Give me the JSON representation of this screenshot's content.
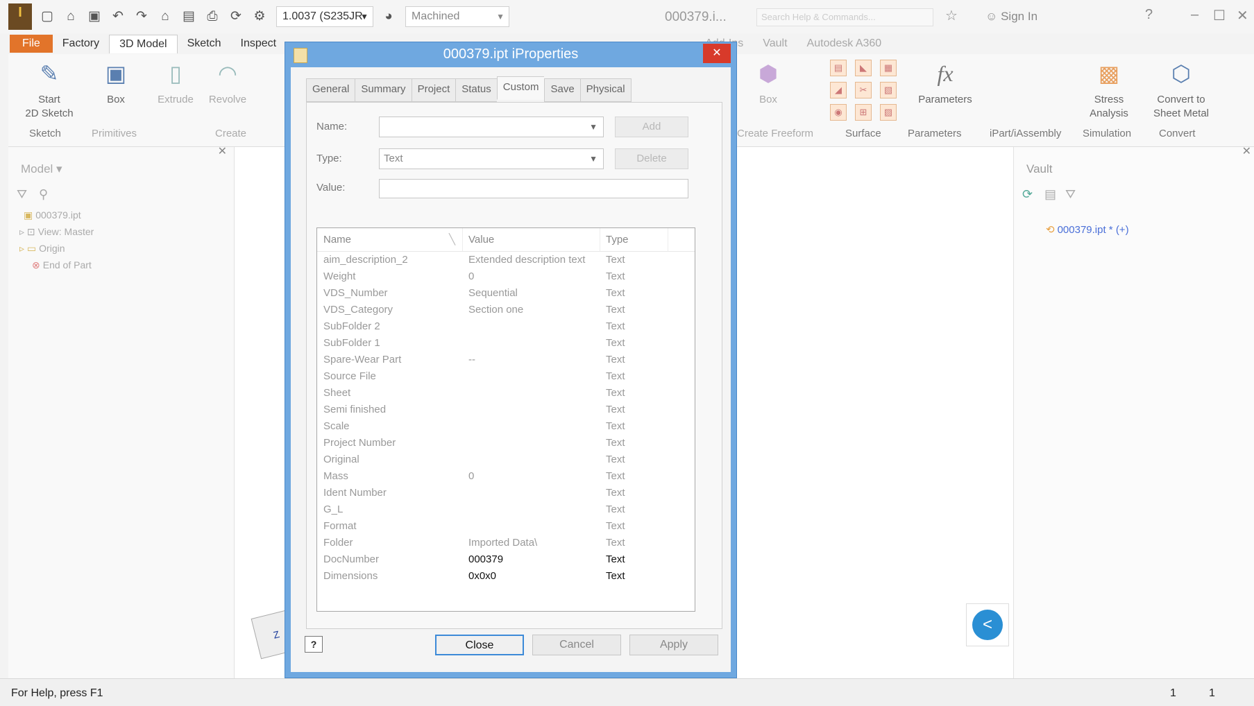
{
  "titlebar": {
    "material": "1.0037 (S235JR",
    "appearance": "Machined",
    "title": "000379.i...",
    "search_placeholder": "Search Help & Commands...",
    "sign_in": "Sign In"
  },
  "ribbon_tabs": [
    "File",
    "Factory",
    "3D Model",
    "Sketch",
    "Inspect",
    "Add-Ins",
    "Vault",
    "Autodesk A360"
  ],
  "ribbon": {
    "start_sketch": [
      "Start",
      "2D Sketch"
    ],
    "box": "Box",
    "extrude": "Extrude",
    "revolve": "Revolve",
    "freeform_box": "Box",
    "parameters": "Parameters",
    "stress": [
      "Stress",
      "Analysis"
    ],
    "sheetmetal": [
      "Convert to",
      "Sheet Metal"
    ],
    "panels": {
      "sketch": "Sketch",
      "primitives": "Primitives",
      "create": "Create",
      "create_freeform": "Create Freeform",
      "surface": "Surface",
      "parameters": "Parameters",
      "ipart": "iPart/iAssembly",
      "simulation": "Simulation",
      "convert": "Convert"
    }
  },
  "model_browser": {
    "title": "Model",
    "items": [
      "000379.ipt",
      "View: Master",
      "Origin",
      "End of Part"
    ]
  },
  "vault_panel": {
    "title": "Vault",
    "item": "000379.ipt * (+)"
  },
  "statusbar": {
    "help": "For Help, press F1",
    "n1": "1",
    "n2": "1"
  },
  "dialog": {
    "title": "000379.ipt iProperties",
    "tabs": [
      "General",
      "Summary",
      "Project",
      "Status",
      "Custom",
      "Save",
      "Physical"
    ],
    "active_tab": "Custom",
    "name_label": "Name:",
    "type_label": "Type:",
    "value_label": "Value:",
    "type_value": "Text",
    "add_label": "Add",
    "delete_label": "Delete",
    "columns": [
      "Name",
      "Value",
      "Type"
    ],
    "rows": [
      {
        "name": "aim_description_2",
        "value": "Extended description text",
        "type": "Text"
      },
      {
        "name": "Weight",
        "value": "0",
        "type": "Text"
      },
      {
        "name": "VDS_Number",
        "value": "Sequential",
        "type": "Text"
      },
      {
        "name": "VDS_Category",
        "value": "Section one",
        "type": "Text"
      },
      {
        "name": "SubFolder 2",
        "value": "",
        "type": "Text"
      },
      {
        "name": "SubFolder 1",
        "value": "",
        "type": "Text"
      },
      {
        "name": "Spare-Wear Part",
        "value": "--",
        "type": "Text"
      },
      {
        "name": "Source File",
        "value": "",
        "type": "Text"
      },
      {
        "name": "Sheet",
        "value": "",
        "type": "Text"
      },
      {
        "name": "Semi finished",
        "value": "",
        "type": "Text"
      },
      {
        "name": "Scale",
        "value": "",
        "type": "Text"
      },
      {
        "name": "Project Number",
        "value": "",
        "type": "Text"
      },
      {
        "name": "Original",
        "value": "",
        "type": "Text"
      },
      {
        "name": "Mass",
        "value": "0",
        "type": "Text"
      },
      {
        "name": "Ident Number",
        "value": "",
        "type": "Text"
      },
      {
        "name": "G_L",
        "value": "",
        "type": "Text"
      },
      {
        "name": "Format",
        "value": "",
        "type": "Text"
      },
      {
        "name": "Folder",
        "value": "Imported Data\\",
        "type": "Text"
      },
      {
        "name": "DocNumber",
        "value": "000379",
        "type": "Text"
      },
      {
        "name": "Dimensions",
        "value": "0x0x0",
        "type": "Text"
      }
    ],
    "close_label": "Close",
    "cancel_label": "Cancel",
    "apply_label": "Apply"
  },
  "colors": {
    "file_tab": "#e2742a",
    "dialog_border": "#6fa8e0",
    "close_btn": "#d83a2a"
  }
}
